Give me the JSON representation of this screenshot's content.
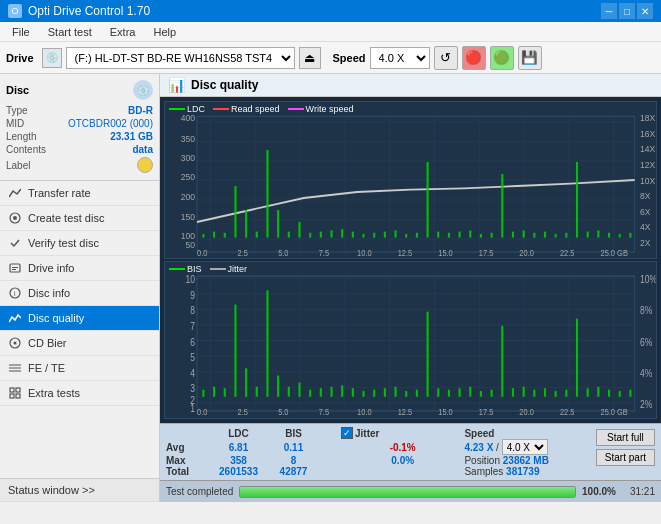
{
  "window": {
    "title": "Opti Drive Control 1.70",
    "minimize": "─",
    "maximize": "□",
    "close": "✕"
  },
  "menu": {
    "items": [
      "File",
      "Start test",
      "Extra",
      "Help"
    ]
  },
  "toolbar": {
    "drive_label": "Drive",
    "drive_value": "(F:)  HL-DT-ST BD-RE  WH16NS58 TST4",
    "speed_label": "Speed",
    "speed_value": "4.0 X"
  },
  "sidebar": {
    "disc_section": {
      "title": "Disc",
      "type_label": "Type",
      "type_value": "BD-R",
      "mid_label": "MID",
      "mid_value": "OTCBDR002 (000)",
      "length_label": "Length",
      "length_value": "23.31 GB",
      "contents_label": "Contents",
      "contents_value": "data",
      "label_label": "Label"
    },
    "nav_items": [
      {
        "id": "transfer-rate",
        "label": "Transfer rate",
        "icon": "chart"
      },
      {
        "id": "create-test-disc",
        "label": "Create test disc",
        "icon": "disc"
      },
      {
        "id": "verify-test-disc",
        "label": "Verify test disc",
        "icon": "verify"
      },
      {
        "id": "drive-info",
        "label": "Drive info",
        "icon": "info"
      },
      {
        "id": "disc-info",
        "label": "Disc info",
        "icon": "disc-info"
      },
      {
        "id": "disc-quality",
        "label": "Disc quality",
        "icon": "quality",
        "active": true
      },
      {
        "id": "cd-bier",
        "label": "CD Bier",
        "icon": "cd"
      },
      {
        "id": "fe-te",
        "label": "FE / TE",
        "icon": "fe"
      },
      {
        "id": "extra-tests",
        "label": "Extra tests",
        "icon": "extra"
      }
    ],
    "status_window": "Status window >>"
  },
  "content": {
    "header": "Disc quality",
    "chart1": {
      "legend": [
        {
          "label": "LDC",
          "color": "#00cc00"
        },
        {
          "label": "Read speed",
          "color": "#ff4444"
        },
        {
          "label": "Write speed",
          "color": "#ff44ff"
        }
      ],
      "y_axis_left": [
        "400",
        "350",
        "300",
        "250",
        "200",
        "150",
        "100",
        "50"
      ],
      "y_axis_right": [
        "18X",
        "16X",
        "14X",
        "12X",
        "10X",
        "8X",
        "6X",
        "4X",
        "2X"
      ],
      "x_axis": [
        "0.0",
        "2.5",
        "5.0",
        "7.5",
        "10.0",
        "12.5",
        "15.0",
        "17.5",
        "20.0",
        "22.5",
        "25.0 GB"
      ]
    },
    "chart2": {
      "legend": [
        {
          "label": "BIS",
          "color": "#00cc00"
        },
        {
          "label": "Jitter",
          "color": "#888888"
        }
      ],
      "y_axis_left": [
        "10",
        "9",
        "8",
        "7",
        "6",
        "5",
        "4",
        "3",
        "2",
        "1"
      ],
      "y_axis_right": [
        "10%",
        "8%",
        "6%",
        "4%",
        "2%"
      ],
      "x_axis": [
        "0.0",
        "2.5",
        "5.0",
        "7.5",
        "10.0",
        "12.5",
        "15.0",
        "17.5",
        "20.0",
        "22.5",
        "25.0 GB"
      ]
    },
    "stats": {
      "columns": [
        "",
        "LDC",
        "BIS",
        "",
        "Jitter",
        "Speed",
        ""
      ],
      "avg_label": "Avg",
      "avg_ldc": "6.81",
      "avg_bis": "0.11",
      "avg_jitter": "-0.1%",
      "max_label": "Max",
      "max_ldc": "358",
      "max_bis": "8",
      "max_jitter": "0.0%",
      "total_label": "Total",
      "total_ldc": "2601533",
      "total_bis": "42877",
      "speed_current": "4.23 X",
      "speed_setting": "4.0 X",
      "position_label": "Position",
      "position_value": "23862 MB",
      "samples_label": "Samples",
      "samples_value": "381739",
      "btn_start_full": "Start full",
      "btn_start_part": "Start part"
    },
    "status_bar": {
      "text": "Test completed",
      "progress": 100,
      "time": "31:21"
    }
  }
}
